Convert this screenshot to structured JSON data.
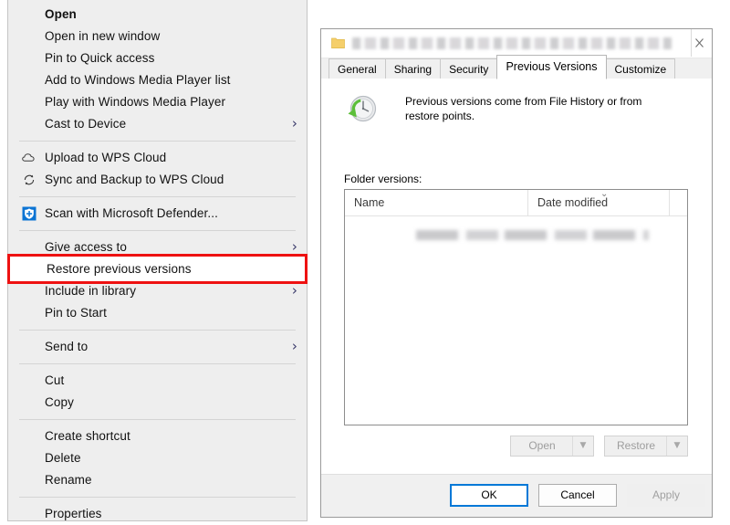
{
  "context_menu": {
    "groups": [
      {
        "items": [
          {
            "label": "Open",
            "bold": true,
            "icon": null,
            "submenu": false
          },
          {
            "label": "Open in new window",
            "bold": false,
            "icon": null,
            "submenu": false
          },
          {
            "label": "Pin to Quick access",
            "bold": false,
            "icon": null,
            "submenu": false
          },
          {
            "label": "Add to Windows Media Player list",
            "bold": false,
            "icon": null,
            "submenu": false
          },
          {
            "label": "Play with Windows Media Player",
            "bold": false,
            "icon": null,
            "submenu": false
          },
          {
            "label": "Cast to Device",
            "bold": false,
            "icon": null,
            "submenu": true
          }
        ]
      },
      {
        "items": [
          {
            "label": "Upload to WPS Cloud",
            "bold": false,
            "icon": "cloud-icon",
            "submenu": false
          },
          {
            "label": "Sync and Backup to WPS Cloud",
            "bold": false,
            "icon": "sync-icon",
            "submenu": false
          }
        ]
      },
      {
        "items": [
          {
            "label": "Scan with Microsoft Defender...",
            "bold": false,
            "icon": "shield-icon",
            "submenu": false
          }
        ]
      },
      {
        "items": [
          {
            "label": "Give access to",
            "bold": false,
            "icon": null,
            "submenu": true
          },
          {
            "label": "Restore previous versions",
            "bold": false,
            "icon": null,
            "submenu": false,
            "highlighted": true
          },
          {
            "label": "Include in library",
            "bold": false,
            "icon": null,
            "submenu": true
          },
          {
            "label": "Pin to Start",
            "bold": false,
            "icon": null,
            "submenu": false
          }
        ]
      },
      {
        "items": [
          {
            "label": "Send to",
            "bold": false,
            "icon": null,
            "submenu": true
          }
        ]
      },
      {
        "items": [
          {
            "label": "Cut",
            "bold": false,
            "icon": null,
            "submenu": false
          },
          {
            "label": "Copy",
            "bold": false,
            "icon": null,
            "submenu": false
          }
        ]
      },
      {
        "items": [
          {
            "label": "Create shortcut",
            "bold": false,
            "icon": null,
            "submenu": false
          },
          {
            "label": "Delete",
            "bold": false,
            "icon": null,
            "submenu": false
          },
          {
            "label": "Rename",
            "bold": false,
            "icon": null,
            "submenu": false
          }
        ]
      },
      {
        "items": [
          {
            "label": "Properties",
            "bold": false,
            "icon": null,
            "submenu": false
          }
        ]
      }
    ],
    "highlight_color": "#ee1111",
    "submenu_glyph": "›"
  },
  "dialog": {
    "title": "",
    "title_redacted": true,
    "folder_icon": "folder-icon",
    "close_glyph": "×",
    "tabs": [
      {
        "label": "General",
        "active": false
      },
      {
        "label": "Sharing",
        "active": false
      },
      {
        "label": "Security",
        "active": false
      },
      {
        "label": "Previous Versions",
        "active": true
      },
      {
        "label": "Customize",
        "active": false
      }
    ],
    "info": {
      "icon": "restore-clock-icon",
      "text": "Previous versions come from File History or from restore points."
    },
    "list": {
      "label": "Folder versions:",
      "columns": [
        "Name",
        "Date modified"
      ],
      "sort_glyph": "⌄",
      "rows": [
        {
          "name": "",
          "date_modified": "",
          "redacted": true
        }
      ]
    },
    "item_buttons": [
      {
        "label": "Open",
        "enabled": false,
        "has_dropdown": true,
        "dropdown_glyph": "▼"
      },
      {
        "label": "Restore",
        "enabled": false,
        "has_dropdown": true,
        "dropdown_glyph": "▼"
      }
    ],
    "footer_buttons": [
      {
        "label": "OK",
        "enabled": true,
        "focused": true
      },
      {
        "label": "Cancel",
        "enabled": true,
        "focused": false
      },
      {
        "label": "Apply",
        "enabled": false,
        "focused": false
      }
    ],
    "accent_color": "#0078d7"
  }
}
